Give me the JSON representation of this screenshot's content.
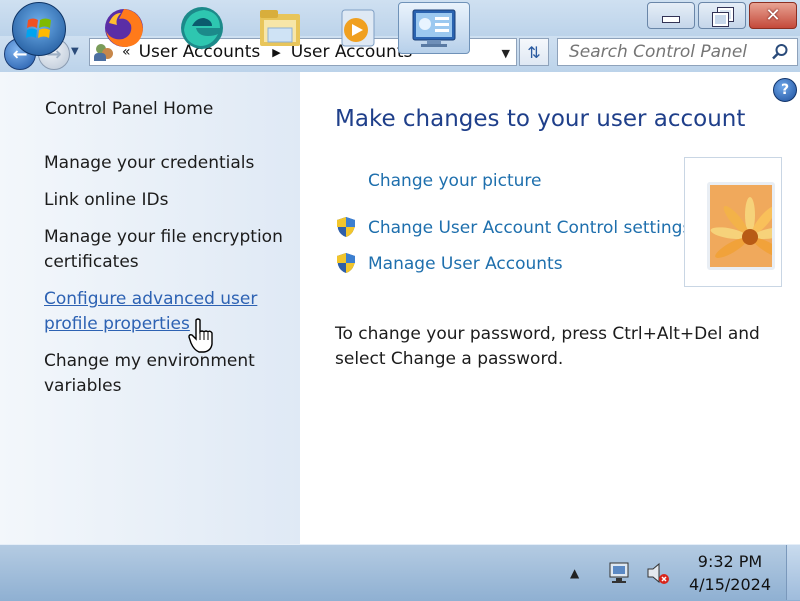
{
  "window": {
    "minimize_label": "minimize",
    "maximize_label": "restore",
    "close_label": "close"
  },
  "address_bar": {
    "overflow_glyph": "«",
    "crumbs": [
      "User Accounts",
      "User Accounts"
    ]
  },
  "search": {
    "placeholder": "Search Control Panel"
  },
  "left_pane": {
    "home": "Control Panel Home",
    "items": [
      "Manage your credentials",
      "Link online IDs",
      "Manage your file encryption certificates",
      "Configure advanced user profile properties",
      "Change my environment variables"
    ]
  },
  "main": {
    "heading": "Make changes to your user account",
    "tasks": [
      "Change your picture",
      "Change User Account Control settings",
      "Manage User Accounts"
    ],
    "password_note": "To change your password, press Ctrl+Alt+Del and select Change a password."
  },
  "taskbar": {
    "time": "9:32 PM",
    "date": "4/15/2024",
    "pinned": [
      "firefox-icon",
      "edge-icon",
      "file-explorer-icon",
      "media-player-icon",
      "control-panel-icon"
    ],
    "active_app": "control-panel-icon"
  },
  "colors": {
    "heading": "#1f3f8a",
    "task_link": "#1e6fad",
    "hover_link": "#2d62b3",
    "left_pane": "#e6eef7"
  }
}
